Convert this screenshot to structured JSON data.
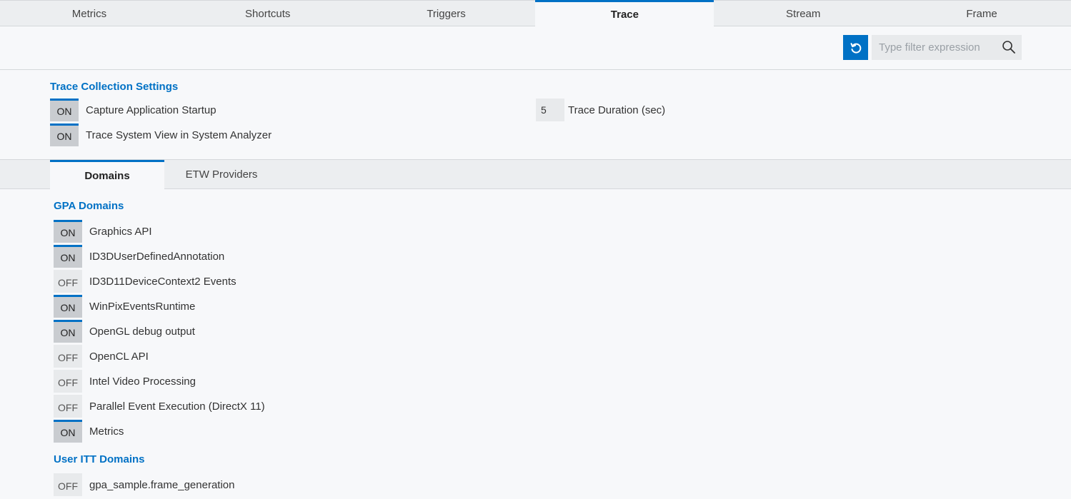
{
  "top_tabs": [
    "Metrics",
    "Shortcuts",
    "Triggers",
    "Trace",
    "Stream",
    "Frame"
  ],
  "active_top_tab": "Trace",
  "search": {
    "placeholder": "Type filter expression",
    "value": ""
  },
  "trace_settings": {
    "title": "Trace Collection Settings",
    "capture_startup": {
      "state": "ON",
      "label": "Capture Application Startup"
    },
    "system_view": {
      "state": "ON",
      "label": "Trace System View in System Analyzer"
    },
    "duration": {
      "value": "5",
      "label": "Trace Duration (sec)"
    }
  },
  "sub_tabs": {
    "domains": "Domains",
    "etw": "ETW Providers"
  },
  "gpa_domains": {
    "title": "GPA Domains",
    "items": [
      {
        "state": "ON",
        "label": "Graphics API"
      },
      {
        "state": "ON",
        "label": "ID3DUserDefinedAnnotation"
      },
      {
        "state": "OFF",
        "label": "ID3D11DeviceContext2 Events"
      },
      {
        "state": "ON",
        "label": "WinPixEventsRuntime"
      },
      {
        "state": "ON",
        "label": "OpenGL debug output"
      },
      {
        "state": "OFF",
        "label": "OpenCL API"
      },
      {
        "state": "OFF",
        "label": "Intel Video Processing"
      },
      {
        "state": "OFF",
        "label": "Parallel Event Execution (DirectX 11)"
      },
      {
        "state": "ON",
        "label": "Metrics"
      }
    ]
  },
  "user_itt_domains": {
    "title": "User ITT Domains",
    "items": [
      {
        "state": "OFF",
        "label": "gpa_sample.frame_generation"
      }
    ]
  },
  "colors": {
    "accent": "#0071c5",
    "toggle_on": "#c9ccd0",
    "toggle_off": "#e8eaec"
  },
  "icons": {
    "refresh": "refresh-icon",
    "search": "search-icon"
  }
}
